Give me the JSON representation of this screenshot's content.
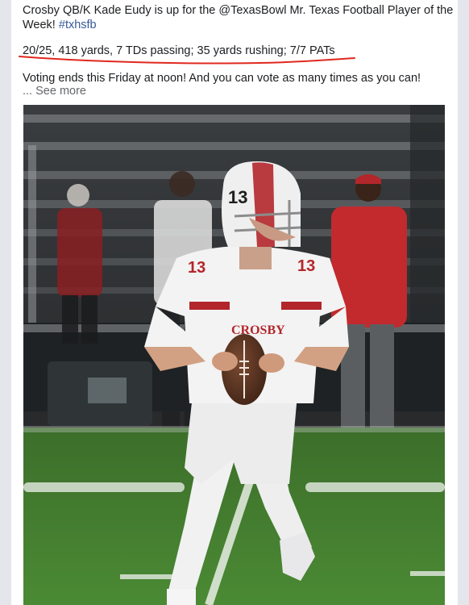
{
  "post": {
    "line1_text": "Crosby QB/K Kade Eudy is up for the @TexasBowl Mr. Texas Football Player of the",
    "line2_text": "Week!",
    "hashtag": "#txhsfb",
    "stats": "20/25, 418 yards, 7 TDs passing; 35 yards rushing; 7/7 PATs",
    "voting": "Voting ends this Friday at noon!  And you can vote as many times as you can!",
    "see_more": "... See more"
  },
  "photo": {
    "jersey_number": "13",
    "jersey_team": "CROSBY",
    "helmet_number": "13",
    "subject": "football-player-photo"
  },
  "colors": {
    "hashtag": "#385898",
    "underline": "#e0281e",
    "muted": "#65676b",
    "jersey_red": "#b3262b",
    "field_green": "#3f7d2e"
  }
}
